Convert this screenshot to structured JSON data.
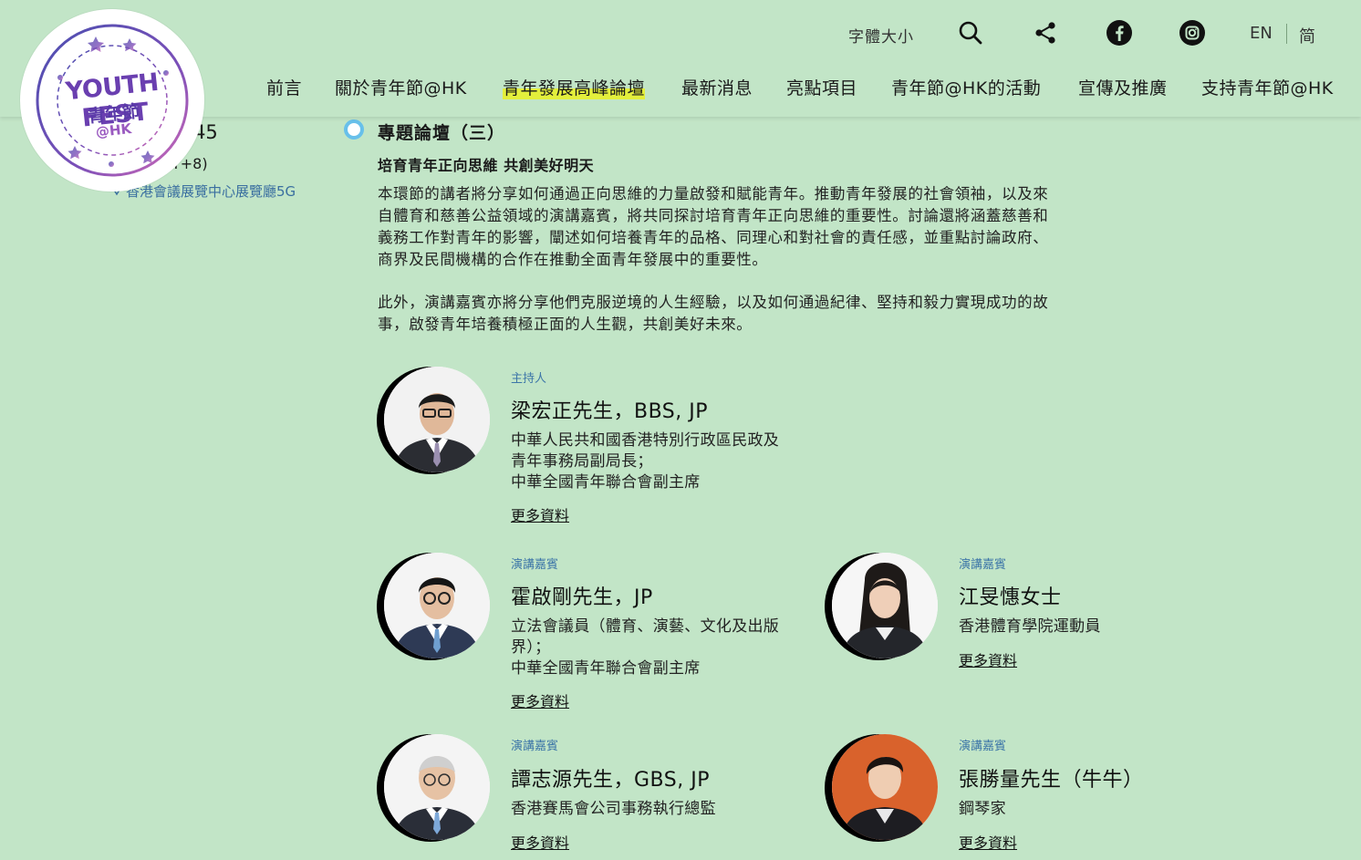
{
  "logo": {
    "text_main": "YOUTH FEST",
    "text_cn": "青年節",
    "text_tag": "@HK"
  },
  "header": {
    "font_size_label": "字體大小",
    "lang_en": "EN",
    "lang_sc": "简",
    "nav": [
      {
        "label": "前言"
      },
      {
        "label": "關於青年節@HK"
      },
      {
        "label": "青年發展高峰論壇"
      },
      {
        "label": "最新消息"
      },
      {
        "label": "亮點項目"
      },
      {
        "label": "青年節@HK的活動"
      },
      {
        "label": "宣傳及推廣"
      },
      {
        "label": "支持青年節@HK"
      }
    ],
    "active_nav": "青年發展高峰論壇",
    "accent_color": "#e3ef3c",
    "background_color": "#c2e5c7"
  },
  "info": {
    "time_partial": ":45",
    "tz_partial": "T+8)",
    "venue": "香港會議展覽中心展覽廳5G"
  },
  "session": {
    "title": "專題論壇（三）",
    "subtitle": "培育青年正向思維 共創美好明天",
    "desc1": "本環節的講者將分享如何通過正向思維的力量啟發和賦能青年。推動青年發展的社會領袖，以及來自體育和慈善公益領域的演講嘉賓，將共同探討培育青年正向思維的重要性。討論還將涵蓋慈善和義務工作對青年的影響，闡述如何培養青年的品格、同理心和對社會的責任感，並重點討論政府、商界及民間機構的合作在推動全面青年發展中的重要性。",
    "desc2": "此外，演講嘉賓亦將分享他們克服逆境的人生經驗，以及如何通過紀律、堅持和毅力實現成功的故事，啟發青年培養積極正面的人生觀，共創美好未來。"
  },
  "speakers": [
    {
      "role": "主持人",
      "name": "梁宏正先生，BBS, JP",
      "titles": [
        "中華人民共和國香港特別行政區民政及",
        "青年事務局副局長；",
        "中華全國青年聯合會副主席"
      ],
      "more": "更多資料"
    },
    {
      "role": "演講嘉賓",
      "name": "霍啟剛先生，JP",
      "titles": [
        "立法會議員（體育、演藝、文化及出版",
        "界）；",
        "中華全國青年聯合會副主席"
      ],
      "more": "更多資料"
    },
    {
      "role": "演講嘉賓",
      "name": "江旻憓女士",
      "titles": [
        "香港體育學院運動員"
      ],
      "more": "更多資料"
    },
    {
      "role": "演講嘉賓",
      "name": "譚志源先生，GBS, JP",
      "titles": [
        "香港賽馬會公司事務執行總監"
      ],
      "more": "更多資料"
    },
    {
      "role": "演講嘉賓",
      "name": "張勝量先生（牛牛）",
      "titles": [
        "鋼琴家"
      ],
      "more": "更多資料"
    }
  ]
}
